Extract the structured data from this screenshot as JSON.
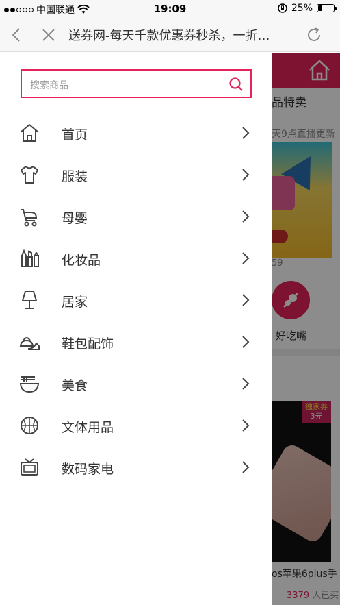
{
  "status_bar": {
    "carrier": "中国联通",
    "time": "19:09",
    "battery": "25%",
    "battery_level": 0.25,
    "signal_bars": 2
  },
  "browser": {
    "title": "送券网-每天千款优惠券秒杀，一折…",
    "icons": [
      "back-icon",
      "close-icon",
      "refresh-icon"
    ]
  },
  "drawer": {
    "search": {
      "placeholder": "搜索商品",
      "icon": "search-icon"
    },
    "menu": [
      {
        "label": "首页",
        "icon": "home-icon"
      },
      {
        "label": "服装",
        "icon": "tshirt-icon"
      },
      {
        "label": "母婴",
        "icon": "stroller-icon"
      },
      {
        "label": "化妆品",
        "icon": "cosmetics-icon"
      },
      {
        "label": "居家",
        "icon": "lamp-icon"
      },
      {
        "label": "鞋包配饰",
        "icon": "shoe-bag-icon"
      },
      {
        "label": "美食",
        "icon": "noodle-bowl-icon"
      },
      {
        "label": "文体用品",
        "icon": "basketball-icon"
      },
      {
        "label": "数码家电",
        "icon": "tv-icon"
      }
    ]
  },
  "background_page": {
    "section_title": "品特卖",
    "section_subtitle": "天9点直播更新",
    "banner_text_partial": "59",
    "category_label": "好吃嘴",
    "product": {
      "badge_line1": "独家券",
      "badge_line2": "3元",
      "name_partial": "os苹果6plus手",
      "sold_count": "3379",
      "sold_suffix": "人已买"
    }
  },
  "colors": {
    "accent": "#e4245a",
    "text": "#333333",
    "muted": "#999999"
  }
}
